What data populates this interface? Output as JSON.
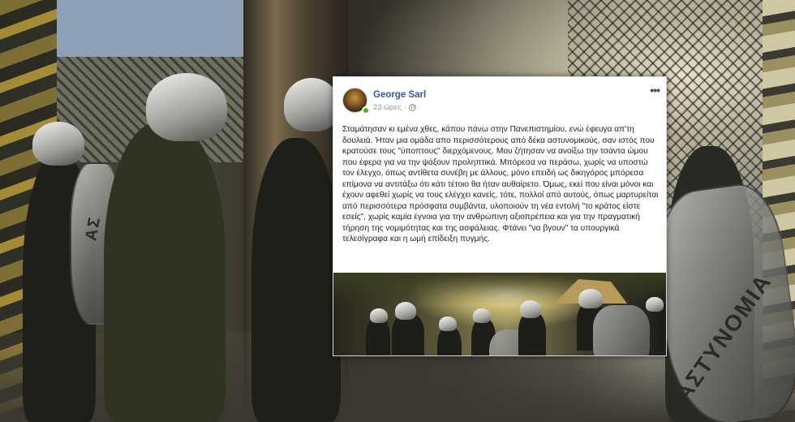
{
  "background": {
    "shield_text": "ΑΣΤΥΝΟΜΙΑ",
    "shield_text_left": "ΑΣ"
  },
  "post": {
    "author": "George Sarl",
    "timestamp": "23 ώρες",
    "separator": "·",
    "privacy_icon": "globe-icon",
    "more_icon": "ellipsis-icon",
    "text": "Σταμάτησαν κι εμένα χθες, κάπου πάνω στην Πανεπιστημίου, ενώ έφευγα απ'τη δουλειά. Ήταν μια ομάδα απο περισσότερους από δέκα αστυνομικούς, σαν ιστός που κρατούσε τους \"ύποπτους\" διερχόμενους. Μου ζήτησαν να ανοίξω την τσάντα ώμου που έφερα για να την ψάξουν προληπτικά. Μπόρεσα να περάσω, χωρίς να υποστώ τον έλεγχο, όπως αντίθετα συνέβη με άλλους, μόνο επειδή ως δικηγόρος μπόρεσα επίμονα να αντιτάξω ότι κάτι τέτοιο θα ήταν αυθαίρετο. Όμως, εκεί που είναι μόνοι και έχουν αφεθεί χωρίς να τους ελέγχει κανείς, τότε, πολλοί από αυτούς, όπως μαρτυρείται από περισσότερα πρόσφατα συμβάντα, υλοποιούν τη νέα εντολή \"το κράτος είστε εσείς\", χωρίς καμία έγνοια για την ανθρώπινη αξιοπρέπεια και για την πραγματική τήρηση της νομιμότητας και της ασφάλειας. Φτάνει \"να βγουν\" τα υπουργικά τελεσίγραφα και η ωμή επίδειξη πυγμής."
  }
}
